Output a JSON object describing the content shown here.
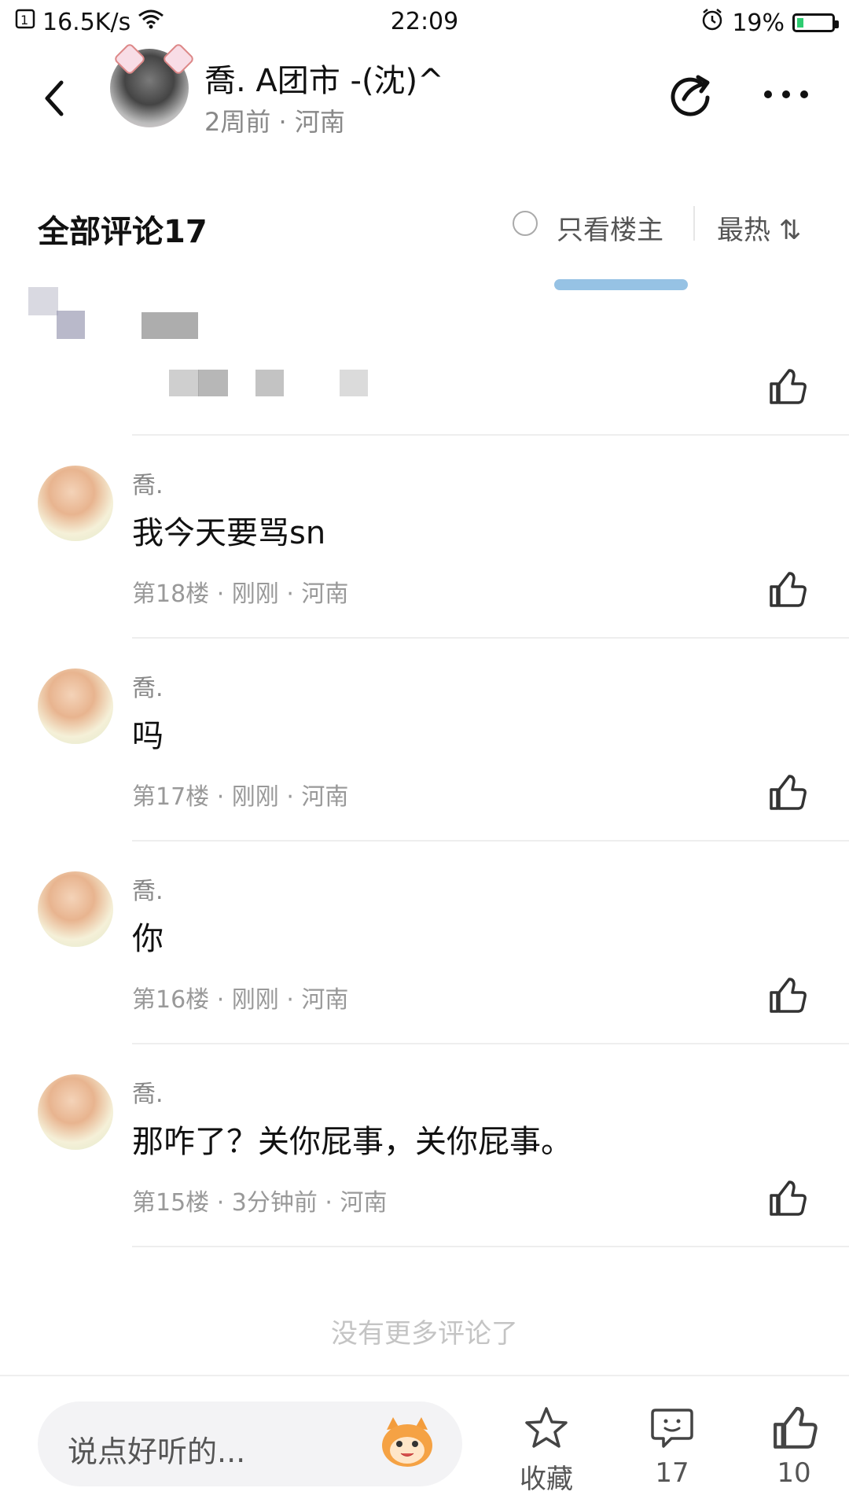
{
  "status_bar": {
    "speed": "16.5K/s",
    "time": "22:09",
    "battery": "19%",
    "battery_level": 0.19
  },
  "header": {
    "title": "喬. A团市 -(沈)^",
    "subtitle": "2周前 · 河南"
  },
  "comment_header": {
    "all_comments": "全部评论17",
    "only_owner": "只看楼主",
    "sort": "最热 ⇅"
  },
  "comments": [
    {
      "name": "喬.",
      "text": "我今天要骂sn",
      "meta": "第18楼 · 刚刚 · 河南"
    },
    {
      "name": "喬.",
      "text": "吗",
      "meta": "第17楼 · 刚刚 · 河南"
    },
    {
      "name": "喬.",
      "text": "你",
      "meta": "第16楼 · 刚刚 · 河南"
    },
    {
      "name": "喬.",
      "text": "那咋了？关你屁事，关你屁事。",
      "meta": "第15楼 · 3分钟前 · 河南"
    }
  ],
  "no_more": "没有更多评论了",
  "bottom_bar": {
    "placeholder": "说点好听的...",
    "favorite_label": "收藏",
    "comment_count": "17",
    "like_count": "10"
  },
  "icons": {
    "back": "chevron-left-icon",
    "share": "share-icon",
    "more": "more-icon",
    "like": "thumb-up-icon",
    "star": "star-icon",
    "comment": "comment-icon",
    "emoji": "emoji-icon"
  },
  "colors": {
    "accent_battery": "#2ecc71",
    "meta_gray": "#999999"
  }
}
